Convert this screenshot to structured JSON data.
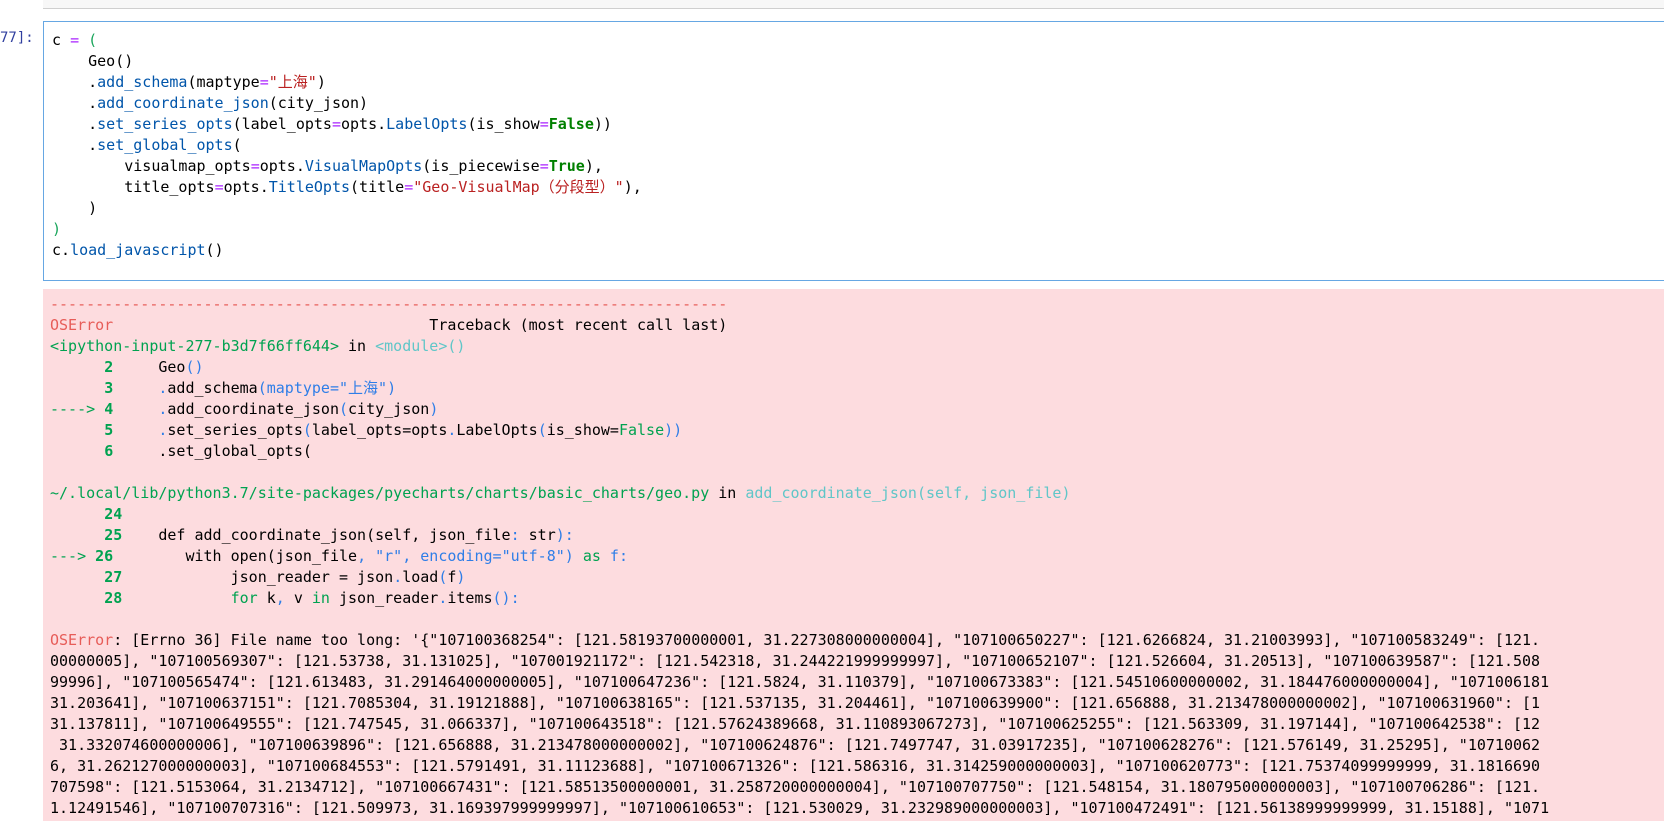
{
  "prompt": "77]:",
  "code_lines": {
    "l1": [
      "c ",
      "=",
      " ",
      "("
    ],
    "l2": [
      "    Geo()"
    ],
    "l3": [
      "    .",
      "add_schema",
      "(maptype",
      "=",
      "\"上海\"",
      ")"
    ],
    "l4": [
      "    .",
      "add_coordinate_json",
      "(city_json)"
    ],
    "l5": [
      "    .",
      "set_series_opts",
      "(label_opts",
      "=",
      "opts.",
      "LabelOpts",
      "(is_show",
      "=",
      "False",
      "))"
    ],
    "l6": [
      "    .",
      "set_global_opts",
      "("
    ],
    "l7": [
      "        visualmap_opts",
      "=",
      "opts.",
      "VisualMapOpts",
      "(is_piecewise",
      "=",
      "True",
      "),"
    ],
    "l8": [
      "        title_opts",
      "=",
      "opts.",
      "TitleOpts",
      "(title",
      "=",
      "\"Geo-VisualMap（分段型）\"",
      "),"
    ],
    "l9": [
      "    )"
    ],
    "l10": [
      ")"
    ],
    "l11": [
      "c.",
      "load_javascript",
      "()"
    ]
  },
  "traceback": {
    "separator": "---------------------------------------------------------------------------",
    "error_name": "OSError",
    "header_pad": "                                   ",
    "header_text": "Traceback (most recent call last)",
    "frame1": {
      "location": "<ipython-input-277-b3d7f66ff644>",
      "in_word": " in ",
      "func": "<module>()"
    },
    "frame1_lines": [
      {
        "marker": "      ",
        "num": "2",
        "code": [
          "Geo",
          "()"
        ]
      },
      {
        "marker": "      ",
        "num": "3",
        "code": [
          ".",
          "add_schema",
          "(",
          "maptype=",
          "\"上海\"",
          ")"
        ]
      },
      {
        "marker": "----> ",
        "num": "4",
        "code": [
          ".",
          "add_coordinate_json",
          "(",
          "city_json",
          ")"
        ]
      },
      {
        "marker": "      ",
        "num": "5",
        "code": [
          ".",
          "set_series_opts",
          "(",
          "label_opts=opts",
          ".",
          "LabelOpts",
          "(",
          "is_show=",
          "False",
          "))"
        ]
      },
      {
        "marker": "      ",
        "num": "6",
        "code": [
          ".set_global_opts("
        ]
      }
    ],
    "frame2": {
      "location": "~/.local/lib/python3.7/site-packages/pyecharts/charts/basic_charts/geo.py",
      "in_word": " in ",
      "func": "add_coordinate_json(self, json_file)"
    },
    "frame2_lines": [
      {
        "marker": "      ",
        "num": "24",
        "code": [
          ""
        ]
      },
      {
        "marker": "      ",
        "num": "25",
        "code": [
          "    def add_coordinate_json(self, json_file",
          ":",
          " str",
          "):"
        ]
      },
      {
        "marker": "---> ",
        "num": "26",
        "code": [
          "        with open(json_file",
          ",",
          " \"r\"",
          ",",
          " encoding=",
          "\"utf-8\"",
          ") ",
          "as",
          " f:"
        ]
      },
      {
        "marker": "      ",
        "num": "27",
        "code": [
          "            json_reader = json",
          ".",
          "load",
          "(",
          "f",
          ")"
        ]
      },
      {
        "marker": "      ",
        "num": "28",
        "code": [
          "            for",
          " k",
          ",",
          " v ",
          "in",
          " json_reader",
          ".",
          "items",
          "():"
        ]
      }
    ],
    "final_error": "OSError",
    "final_lines": [
      ": [Errno 36] File name too long: '{\"107100368254\": [121.58193700000001, 31.227308000000004], \"107100650227\": [121.6266824, 31.21003993], \"107100583249\": [121.",
      "00000005], \"107100569307\": [121.53738, 31.131025], \"107001921172\": [121.542318, 31.244221999999997], \"107100652107\": [121.526604, 31.20513], \"107100639587\": [121.508",
      "99996], \"107100565474\": [121.613483, 31.291464000000005], \"107100647236\": [121.5824, 31.110379], \"107100673383\": [121.54510600000002, 31.184476000000004], \"1071006181",
      "31.203641], \"107100637151\": [121.7085304, 31.19121888], \"107100638165\": [121.537135, 31.204461], \"107100639900\": [121.656888, 31.213478000000002], \"107100631960\": [1",
      "31.137811], \"107100649555\": [121.747545, 31.066337], \"107100643518\": [121.57624389668, 31.110893067273], \"107100625255\": [121.563309, 31.197144], \"107100642538\": [12",
      " 31.332074600000006], \"107100639896\": [121.656888, 31.213478000000002], \"107100624876\": [121.7497747, 31.03917235], \"107100628276\": [121.576149, 31.25295], \"10710062",
      "6, 31.262127000000003], \"107100684553\": [121.5791491, 31.11123688], \"107100671326\": [121.586316, 31.314259000000003], \"107100620773\": [121.75374099999999, 31.1816690",
      "707598\": [121.5153064, 31.2134712], \"107100667431\": [121.58513500000001, 31.258720000000004], \"107100707750\": [121.548154, 31.180795000000003], \"107100706286\": [121.",
      "1.12491546], \"107100707316\": [121.509973, 31.169397999999997], \"107100610653\": [121.530029, 31.232989000000003], \"107100472491\": [121.56138999999999, 31.15188], \"1071"
    ]
  }
}
